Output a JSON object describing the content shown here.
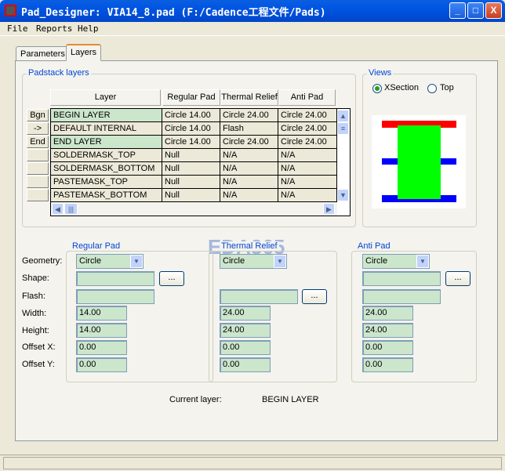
{
  "window": {
    "title": "Pad_Designer: VIA14_8.pad (F:/Cadence工程文件/Pads)",
    "minimize": "_",
    "maximize": "□",
    "close": "X"
  },
  "menu": [
    "File",
    "Reports",
    "Help"
  ],
  "tabs": [
    "Parameters",
    "Layers"
  ],
  "padstack": {
    "title": "Padstack layers",
    "headers": [
      "Layer",
      "Regular Pad",
      "Thermal Relief",
      "Anti Pad"
    ],
    "side_buttons": [
      "Bgn",
      "->",
      "End",
      "",
      "",
      "",
      ""
    ],
    "rows": [
      [
        "BEGIN LAYER",
        "Circle 14.00",
        "Circle 24.00",
        "Circle 24.00"
      ],
      [
        "DEFAULT INTERNAL",
        "Circle 14.00",
        "Flash",
        "Circle 24.00"
      ],
      [
        "END LAYER",
        "Circle 14.00",
        "Circle 24.00",
        "Circle 24.00"
      ],
      [
        "SOLDERMASK_TOP",
        "Null",
        "N/A",
        "N/A"
      ],
      [
        "SOLDERMASK_BOTTOM",
        "Null",
        "N/A",
        "N/A"
      ],
      [
        "PASTEMASK_TOP",
        "Null",
        "N/A",
        "N/A"
      ],
      [
        "PASTEMASK_BOTTOM",
        "Null",
        "N/A",
        "N/A"
      ]
    ]
  },
  "views": {
    "title": "Views",
    "xsection": "XSection",
    "top": "Top",
    "selected": "XSection",
    "colors": {
      "pad": "#ff0000",
      "drill": "#00ff00",
      "inner": "#0000ff"
    }
  },
  "labels": {
    "geometry": "Geometry:",
    "shape": "Shape:",
    "flash": "Flash:",
    "width": "Width:",
    "height": "Height:",
    "offset_x": "Offset X:",
    "offset_y": "Offset Y:"
  },
  "regular": {
    "title": "Regular Pad",
    "geometry": "Circle",
    "shape": "",
    "flash": "",
    "width": "14.00",
    "height": "14.00",
    "offset_x": "0.00",
    "offset_y": "0.00",
    "browse": "..."
  },
  "thermal": {
    "title": "Thermal Relief",
    "geometry": "Circle",
    "flash": "",
    "width": "24.00",
    "height": "24.00",
    "offset_x": "0.00",
    "offset_y": "0.00",
    "browse": "..."
  },
  "anti": {
    "title": "Anti Pad",
    "geometry": "Circle",
    "shape": "",
    "flash": "",
    "width": "24.00",
    "height": "24.00",
    "offset_x": "0.00",
    "offset_y": "0.00",
    "browse": "..."
  },
  "current_layer": {
    "label": "Current layer:",
    "value": "BEGIN LAYER"
  },
  "watermark": "EDA365"
}
